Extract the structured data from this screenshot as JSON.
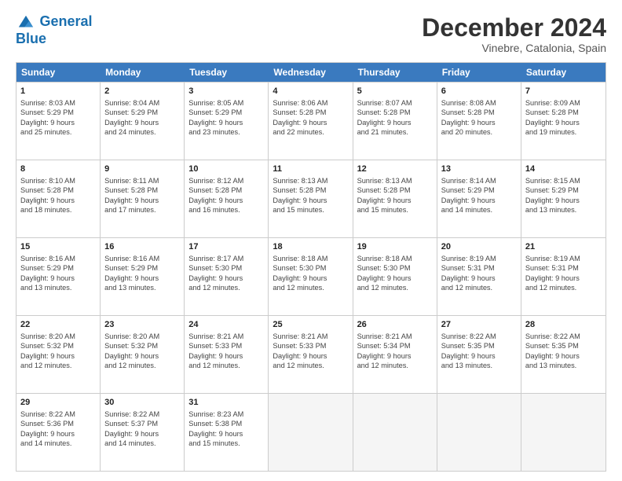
{
  "header": {
    "logo_line1": "General",
    "logo_line2": "Blue",
    "title": "December 2024",
    "subtitle": "Vinebre, Catalonia, Spain"
  },
  "weekdays": [
    "Sunday",
    "Monday",
    "Tuesday",
    "Wednesday",
    "Thursday",
    "Friday",
    "Saturday"
  ],
  "weeks": [
    [
      {
        "day": "1",
        "lines": [
          "Sunrise: 8:03 AM",
          "Sunset: 5:29 PM",
          "Daylight: 9 hours",
          "and 25 minutes."
        ]
      },
      {
        "day": "2",
        "lines": [
          "Sunrise: 8:04 AM",
          "Sunset: 5:29 PM",
          "Daylight: 9 hours",
          "and 24 minutes."
        ]
      },
      {
        "day": "3",
        "lines": [
          "Sunrise: 8:05 AM",
          "Sunset: 5:29 PM",
          "Daylight: 9 hours",
          "and 23 minutes."
        ]
      },
      {
        "day": "4",
        "lines": [
          "Sunrise: 8:06 AM",
          "Sunset: 5:28 PM",
          "Daylight: 9 hours",
          "and 22 minutes."
        ]
      },
      {
        "day": "5",
        "lines": [
          "Sunrise: 8:07 AM",
          "Sunset: 5:28 PM",
          "Daylight: 9 hours",
          "and 21 minutes."
        ]
      },
      {
        "day": "6",
        "lines": [
          "Sunrise: 8:08 AM",
          "Sunset: 5:28 PM",
          "Daylight: 9 hours",
          "and 20 minutes."
        ]
      },
      {
        "day": "7",
        "lines": [
          "Sunrise: 8:09 AM",
          "Sunset: 5:28 PM",
          "Daylight: 9 hours",
          "and 19 minutes."
        ]
      }
    ],
    [
      {
        "day": "8",
        "lines": [
          "Sunrise: 8:10 AM",
          "Sunset: 5:28 PM",
          "Daylight: 9 hours",
          "and 18 minutes."
        ]
      },
      {
        "day": "9",
        "lines": [
          "Sunrise: 8:11 AM",
          "Sunset: 5:28 PM",
          "Daylight: 9 hours",
          "and 17 minutes."
        ]
      },
      {
        "day": "10",
        "lines": [
          "Sunrise: 8:12 AM",
          "Sunset: 5:28 PM",
          "Daylight: 9 hours",
          "and 16 minutes."
        ]
      },
      {
        "day": "11",
        "lines": [
          "Sunrise: 8:13 AM",
          "Sunset: 5:28 PM",
          "Daylight: 9 hours",
          "and 15 minutes."
        ]
      },
      {
        "day": "12",
        "lines": [
          "Sunrise: 8:13 AM",
          "Sunset: 5:28 PM",
          "Daylight: 9 hours",
          "and 15 minutes."
        ]
      },
      {
        "day": "13",
        "lines": [
          "Sunrise: 8:14 AM",
          "Sunset: 5:29 PM",
          "Daylight: 9 hours",
          "and 14 minutes."
        ]
      },
      {
        "day": "14",
        "lines": [
          "Sunrise: 8:15 AM",
          "Sunset: 5:29 PM",
          "Daylight: 9 hours",
          "and 13 minutes."
        ]
      }
    ],
    [
      {
        "day": "15",
        "lines": [
          "Sunrise: 8:16 AM",
          "Sunset: 5:29 PM",
          "Daylight: 9 hours",
          "and 13 minutes."
        ]
      },
      {
        "day": "16",
        "lines": [
          "Sunrise: 8:16 AM",
          "Sunset: 5:29 PM",
          "Daylight: 9 hours",
          "and 13 minutes."
        ]
      },
      {
        "day": "17",
        "lines": [
          "Sunrise: 8:17 AM",
          "Sunset: 5:30 PM",
          "Daylight: 9 hours",
          "and 12 minutes."
        ]
      },
      {
        "day": "18",
        "lines": [
          "Sunrise: 8:18 AM",
          "Sunset: 5:30 PM",
          "Daylight: 9 hours",
          "and 12 minutes."
        ]
      },
      {
        "day": "19",
        "lines": [
          "Sunrise: 8:18 AM",
          "Sunset: 5:30 PM",
          "Daylight: 9 hours",
          "and 12 minutes."
        ]
      },
      {
        "day": "20",
        "lines": [
          "Sunrise: 8:19 AM",
          "Sunset: 5:31 PM",
          "Daylight: 9 hours",
          "and 12 minutes."
        ]
      },
      {
        "day": "21",
        "lines": [
          "Sunrise: 8:19 AM",
          "Sunset: 5:31 PM",
          "Daylight: 9 hours",
          "and 12 minutes."
        ]
      }
    ],
    [
      {
        "day": "22",
        "lines": [
          "Sunrise: 8:20 AM",
          "Sunset: 5:32 PM",
          "Daylight: 9 hours",
          "and 12 minutes."
        ]
      },
      {
        "day": "23",
        "lines": [
          "Sunrise: 8:20 AM",
          "Sunset: 5:32 PM",
          "Daylight: 9 hours",
          "and 12 minutes."
        ]
      },
      {
        "day": "24",
        "lines": [
          "Sunrise: 8:21 AM",
          "Sunset: 5:33 PM",
          "Daylight: 9 hours",
          "and 12 minutes."
        ]
      },
      {
        "day": "25",
        "lines": [
          "Sunrise: 8:21 AM",
          "Sunset: 5:33 PM",
          "Daylight: 9 hours",
          "and 12 minutes."
        ]
      },
      {
        "day": "26",
        "lines": [
          "Sunrise: 8:21 AM",
          "Sunset: 5:34 PM",
          "Daylight: 9 hours",
          "and 12 minutes."
        ]
      },
      {
        "day": "27",
        "lines": [
          "Sunrise: 8:22 AM",
          "Sunset: 5:35 PM",
          "Daylight: 9 hours",
          "and 13 minutes."
        ]
      },
      {
        "day": "28",
        "lines": [
          "Sunrise: 8:22 AM",
          "Sunset: 5:35 PM",
          "Daylight: 9 hours",
          "and 13 minutes."
        ]
      }
    ],
    [
      {
        "day": "29",
        "lines": [
          "Sunrise: 8:22 AM",
          "Sunset: 5:36 PM",
          "Daylight: 9 hours",
          "and 14 minutes."
        ]
      },
      {
        "day": "30",
        "lines": [
          "Sunrise: 8:22 AM",
          "Sunset: 5:37 PM",
          "Daylight: 9 hours",
          "and 14 minutes."
        ]
      },
      {
        "day": "31",
        "lines": [
          "Sunrise: 8:23 AM",
          "Sunset: 5:38 PM",
          "Daylight: 9 hours",
          "and 15 minutes."
        ]
      },
      null,
      null,
      null,
      null
    ]
  ]
}
